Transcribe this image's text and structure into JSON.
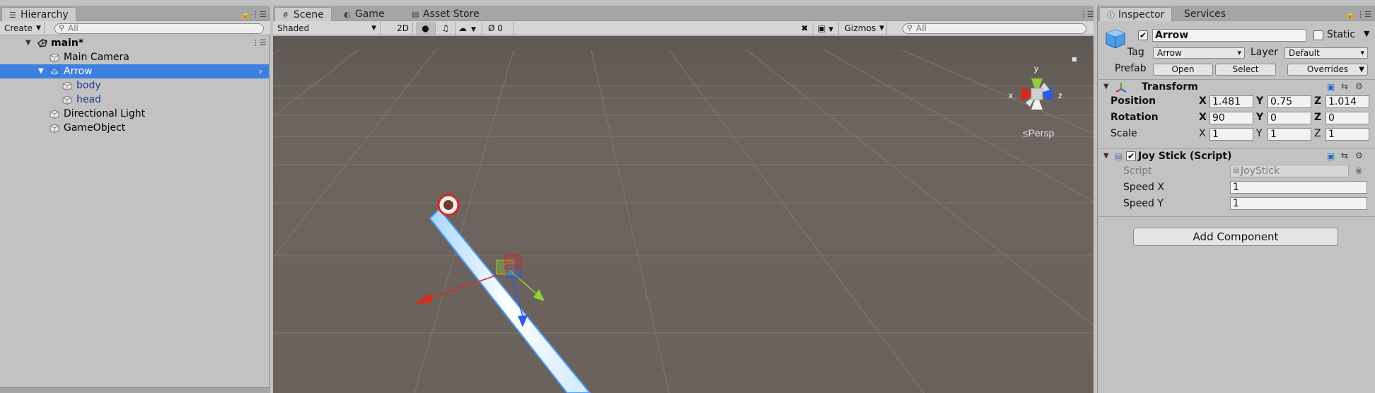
{
  "hierarchy": {
    "tab": "Hierarchy",
    "create_label": "Create",
    "search_placeholder": "All",
    "scene_name": "main*",
    "items": [
      {
        "label": "Main Camera"
      },
      {
        "label": "Arrow"
      },
      {
        "label": "body"
      },
      {
        "label": "head"
      },
      {
        "label": "Directional Light"
      },
      {
        "label": "GameObject"
      }
    ]
  },
  "scene": {
    "tabs": [
      "Scene",
      "Game",
      "Asset Store"
    ],
    "shading_mode": "Shaded",
    "mode_2d": "2D",
    "hidden_count": "0",
    "gizmos_label": "Gizmos",
    "search_placeholder": "All",
    "projection_label": "≤Persp",
    "axis_labels": {
      "x": "x",
      "y": "y",
      "z": "z"
    }
  },
  "inspector": {
    "tabs": [
      "Inspector",
      "Services"
    ],
    "object_name": "Arrow",
    "object_active": true,
    "static_label": "Static",
    "tag_label": "Tag",
    "tag_value": "Arrow",
    "layer_label": "Layer",
    "layer_value": "Default",
    "prefab_label": "Prefab",
    "prefab_open": "Open",
    "prefab_select": "Select",
    "prefab_overrides": "Overrides",
    "transform": {
      "title": "Transform",
      "position_label": "Position",
      "rotation_label": "Rotation",
      "scale_label": "Scale",
      "axis": {
        "x": "X",
        "y": "Y",
        "z": "Z"
      },
      "position": {
        "x": "1.481",
        "y": "0.75",
        "z": "1.014"
      },
      "rotation": {
        "x": "90",
        "y": "0",
        "z": "0"
      },
      "scale": {
        "x": "1",
        "y": "1",
        "z": "1"
      }
    },
    "joystick": {
      "title": "Joy Stick (Script)",
      "script_label": "Script",
      "script_value": "JoyStick",
      "speed_x_label": "Speed X",
      "speed_x_value": "1",
      "speed_y_label": "Speed Y",
      "speed_y_value": "1"
    },
    "add_component": "Add Component"
  },
  "colors": {
    "selection": "#3d80df",
    "scene_background": "#6b625d",
    "axis_x": "#d8291b",
    "axis_y": "#8fd03b",
    "axis_z": "#2a5be0"
  }
}
